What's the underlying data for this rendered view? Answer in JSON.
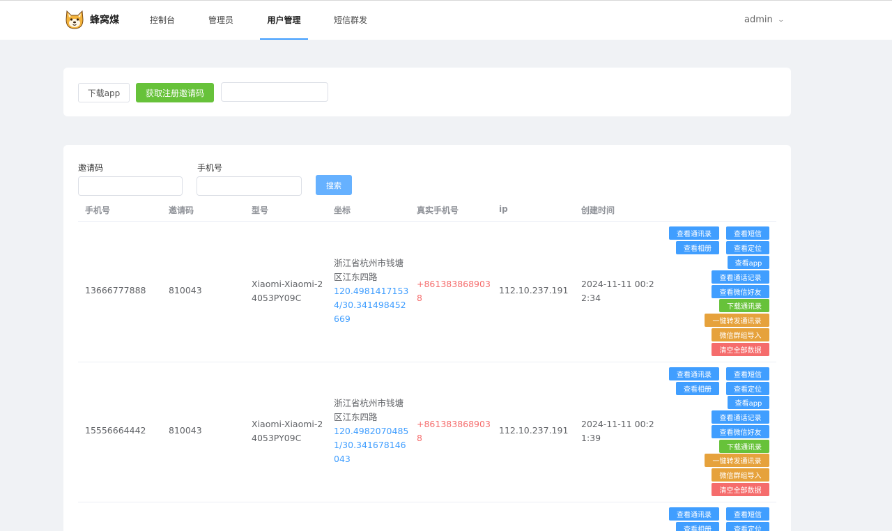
{
  "brand": {
    "name": "蜂窝煤"
  },
  "nav": {
    "items": [
      {
        "label": "控制台"
      },
      {
        "label": "管理员"
      },
      {
        "label": "用户管理",
        "active": true
      },
      {
        "label": "短信群发"
      }
    ],
    "user": "admin"
  },
  "toolbar": {
    "download_label": "下载app",
    "invite_label": "获取注册邀请码",
    "invite_value": ""
  },
  "search": {
    "invite_label": "邀请码",
    "invite_value": "",
    "phone_label": "手机号",
    "phone_value": "",
    "search_label": "搜索"
  },
  "table": {
    "headers": [
      "手机号",
      "邀请码",
      "型号",
      "坐标",
      "真实手机号",
      "ip",
      "创建时间"
    ],
    "action_labels": {
      "contacts": "查看通讯录",
      "sms": "查看短信",
      "album": "查看相册",
      "location": "查看定位",
      "apps": "查看app",
      "calls": "查看通话记录",
      "wechat": "查看微信好友",
      "download_contacts": "下载通讯录",
      "forward_contacts": "一键转发通讯录",
      "wechat_import": "微信群组导入",
      "clear_all": "清空全部数据"
    },
    "rows": [
      {
        "phone": "13666777888",
        "invite": "810043",
        "model_l1": "Xiaomi-Xiaomi-2",
        "model_l2": "4053PY09C",
        "addr_l1": "浙江省杭州市钱塘",
        "addr_l2": "区江东四路",
        "coord_l1": "120.4981417153",
        "coord_l2": "4/30.341498452",
        "coord_l3": "669",
        "real_l1": "+861383868903",
        "real_l2": "8",
        "ip": "112.10.237.191",
        "time_l1": "2024-11-11 00:2",
        "time_l2": "2:34"
      },
      {
        "phone": "15556664442",
        "invite": "810043",
        "model_l1": "Xiaomi-Xiaomi-2",
        "model_l2": "4053PY09C",
        "addr_l1": "浙江省杭州市钱塘",
        "addr_l2": "区江东四路",
        "coord_l1": "120.4982070485",
        "coord_l2": "1/30.341678146",
        "coord_l3": "043",
        "real_l1": "+861383868903",
        "real_l2": "8",
        "ip": "112.10.237.191",
        "time_l1": "2024-11-11 00:2",
        "time_l2": "1:39"
      }
    ]
  },
  "colors": {
    "primary": "#409eff",
    "success": "#67c23a",
    "warning": "#e6a23c",
    "danger": "#f56c6c"
  }
}
